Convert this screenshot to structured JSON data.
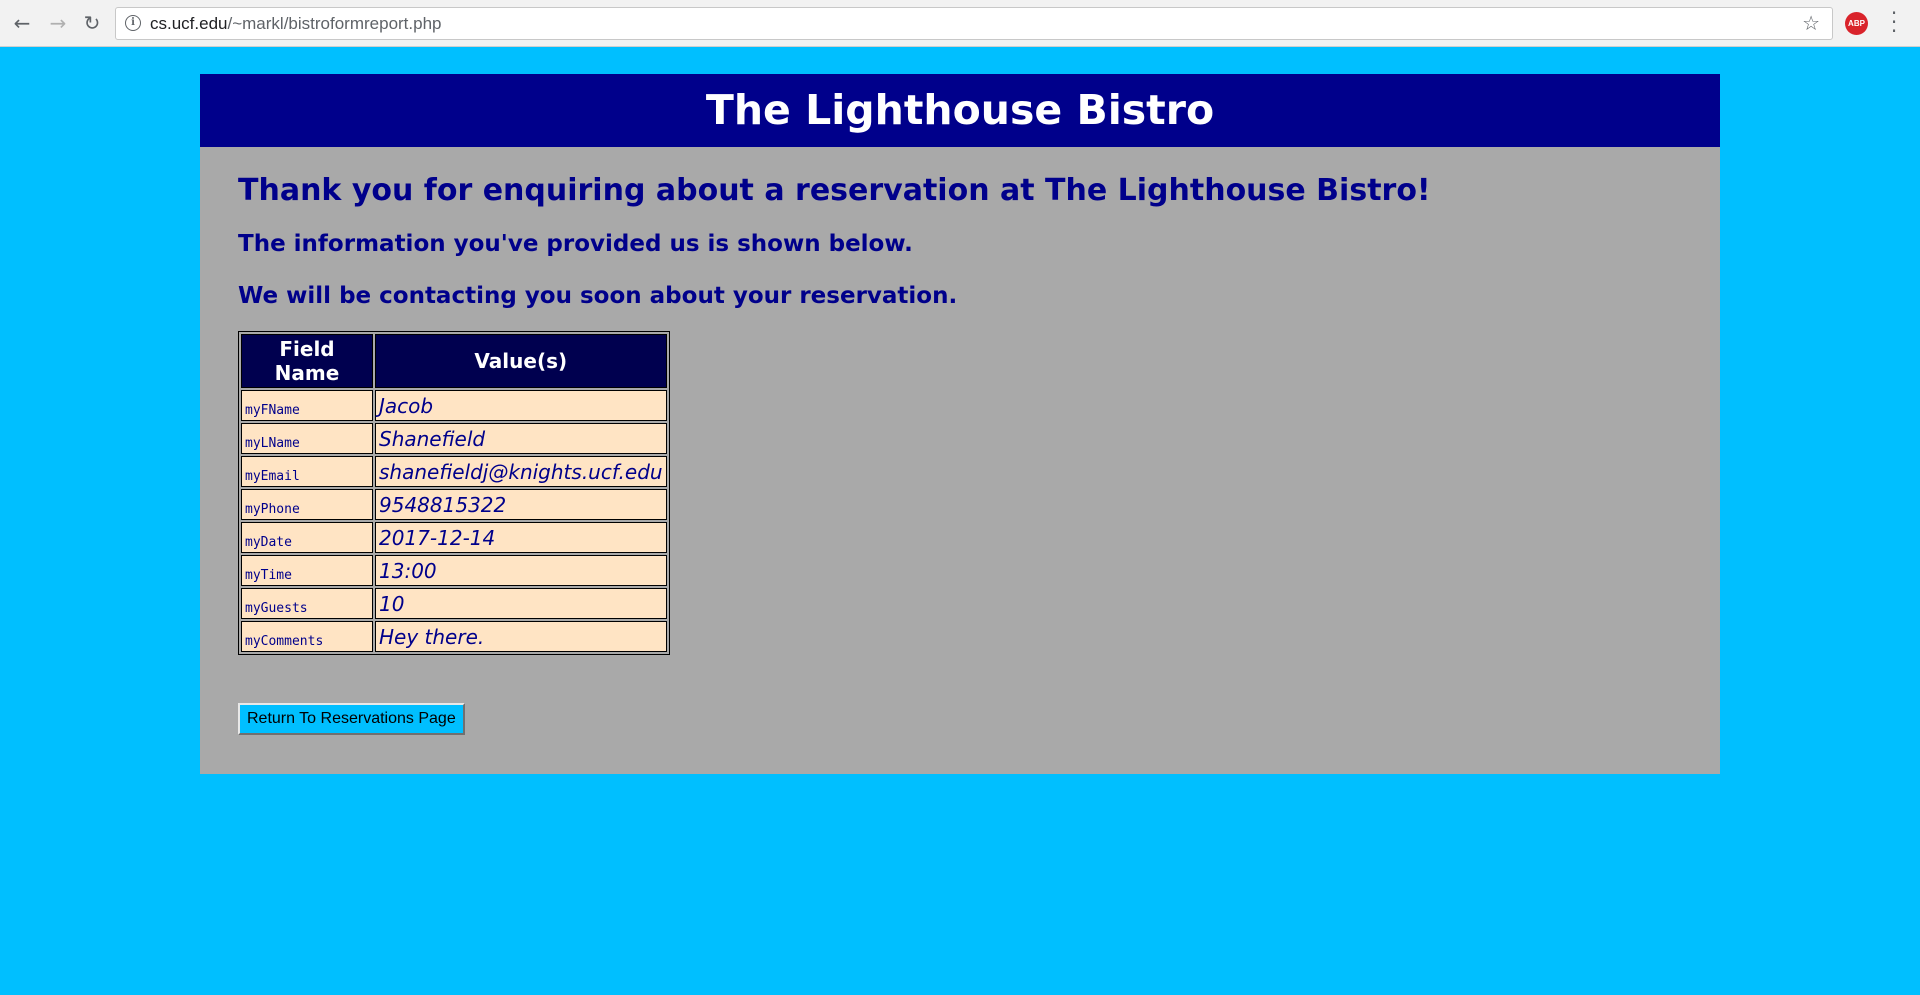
{
  "browser": {
    "url_host": "cs.ucf.edu",
    "url_path": "/~markl/bistroformreport.php",
    "abp_label": "ABP",
    "icons": {
      "back": "arrow-left-icon",
      "forward": "arrow-right-icon",
      "reload": "reload-icon",
      "info": "info-icon",
      "bookmark": "star-icon",
      "adblock": "adblock-icon",
      "menu": "vertical-dots-icon"
    }
  },
  "page": {
    "banner_title": "The Lighthouse Bistro",
    "thanks_heading": "Thank you for enquiring about a reservation at The Lighthouse Bistro!",
    "info_line": "The information you've provided us is shown below.",
    "contact_line": "We will be contacting you soon about your reservation.",
    "colors": {
      "page_background": "#00BFFF",
      "panel_background": "#A9A9A9",
      "banner_background": "#00008B",
      "heading_text": "#00008B",
      "table_header_background": "#00004F",
      "table_cell_background": "#FFE4C4"
    }
  },
  "report": {
    "headers": [
      "Field Name",
      "Value(s)"
    ],
    "rows": [
      {
        "field": "myFName",
        "value": "Jacob"
      },
      {
        "field": "myLName",
        "value": "Shanefield"
      },
      {
        "field": "myEmail",
        "value": "shanefieldj@knights.ucf.edu"
      },
      {
        "field": "myPhone",
        "value": "9548815322"
      },
      {
        "field": "myDate",
        "value": "2017-12-14"
      },
      {
        "field": "myTime",
        "value": "13:00"
      },
      {
        "field": "myGuests",
        "value": "10"
      },
      {
        "field": "myComments",
        "value": "Hey there."
      }
    ]
  },
  "actions": {
    "return_label": "Return To Reservations Page"
  }
}
